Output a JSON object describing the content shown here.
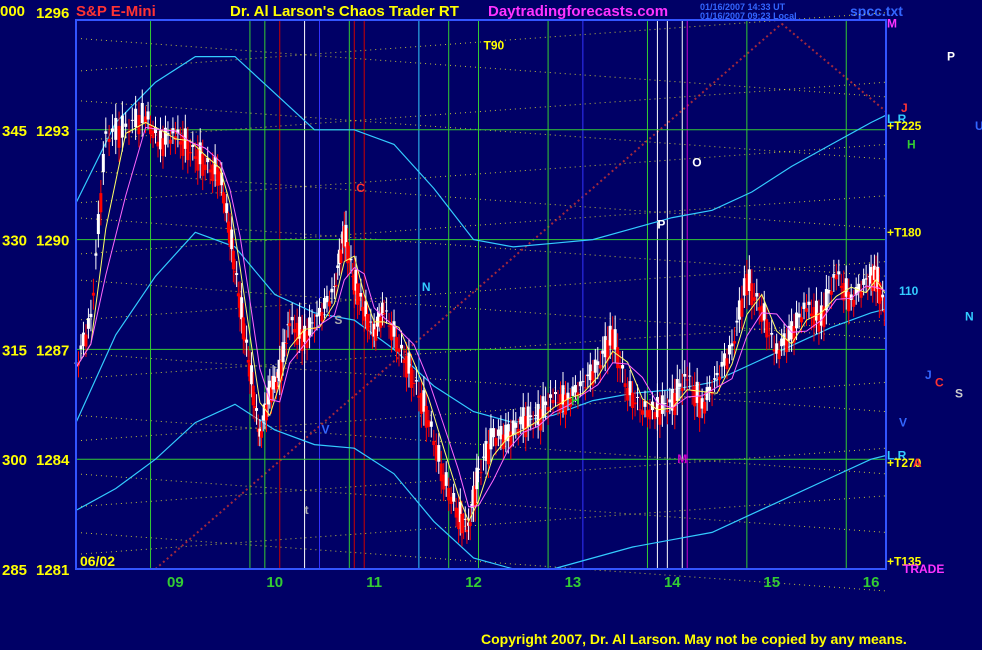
{
  "header": {
    "corner_label": "000",
    "symbol": "S&P E-Mini",
    "app_title": "Dr. Al Larson's Chaos Trader RT",
    "website": "Daytradingforecasts.com",
    "timestamp_line1": "01/16/2007 14:33 UT",
    "timestamp_line2": "01/16/2007 09:23 Local",
    "filename": "spcc.txt"
  },
  "footer": {
    "copyright": "Copyright 2007, Dr. Al Larson. May not be copied by any means."
  },
  "colors": {
    "background": "#000066",
    "grid": "#33cc33",
    "price_up": "#ffffff",
    "price_down": "#ff0000",
    "moving_avg_fast": "#ffff66",
    "moving_avg_slow": "#ff66ff",
    "envelope": "#33ccff",
    "channel_dots_yellow": "#ffff33",
    "channel_dots_red": "#cc3333",
    "axis_text": "#ffff00",
    "title_text": "#ffff00",
    "website_text": "#ff33ff",
    "copyright_text": "#ffff00"
  },
  "chart_data": {
    "type": "line",
    "series_style": "candlestick",
    "x_date_label": "06/02",
    "ylim": [
      1281,
      1296
    ],
    "y_ticks": [
      {
        "angle": "285",
        "price": "1281",
        "value": 1281
      },
      {
        "angle": "300",
        "price": "1284",
        "value": 1284
      },
      {
        "angle": "315",
        "price": "1287",
        "value": 1287
      },
      {
        "angle": "330",
        "price": "1290",
        "value": 1290
      },
      {
        "angle": "345",
        "price": "1293",
        "value": 1293
      },
      {
        "angle": "000",
        "price": "1296",
        "value": 1296
      }
    ],
    "xlim": [
      8.0,
      16.15
    ],
    "x_ticks": [
      {
        "label": "09",
        "value": 9
      },
      {
        "label": "10",
        "value": 10
      },
      {
        "label": "11",
        "value": 11
      },
      {
        "label": "12",
        "value": 12
      },
      {
        "label": "13",
        "value": 13
      },
      {
        "label": "14",
        "value": 14
      },
      {
        "label": "15",
        "value": 15
      },
      {
        "label": "16",
        "value": 16
      }
    ],
    "price": {
      "x": [
        8.0,
        8.15,
        8.3,
        8.5,
        8.7,
        8.85,
        9.0,
        9.15,
        9.3,
        9.45,
        9.55,
        9.65,
        9.75,
        9.85,
        9.95,
        10.05,
        10.15,
        10.3,
        10.45,
        10.6,
        10.7,
        10.8,
        10.9,
        11.0,
        11.1,
        11.25,
        11.4,
        11.55,
        11.7,
        11.85,
        11.95,
        12.05,
        12.2,
        12.35,
        12.5,
        12.65,
        12.8,
        12.95,
        13.1,
        13.25,
        13.4,
        13.55,
        13.7,
        13.85,
        14.0,
        14.15,
        14.3,
        14.45,
        14.6,
        14.75,
        14.9,
        15.05,
        15.2,
        15.35,
        15.5,
        15.65,
        15.8,
        15.95,
        16.05,
        16.15
      ],
      "y": [
        1286.5,
        1287.8,
        1292.8,
        1293.0,
        1293.4,
        1292.6,
        1292.9,
        1292.5,
        1292.1,
        1291.8,
        1290.2,
        1288.3,
        1286.5,
        1284.6,
        1285.8,
        1286.3,
        1287.8,
        1287.3,
        1287.9,
        1288.6,
        1290.2,
        1288.9,
        1288.1,
        1287.4,
        1288.1,
        1287.1,
        1286.2,
        1285.1,
        1283.5,
        1282.5,
        1282.1,
        1283.6,
        1284.6,
        1284.6,
        1285.0,
        1285.1,
        1285.7,
        1285.6,
        1286.0,
        1286.5,
        1287.4,
        1285.9,
        1285.4,
        1285.3,
        1285.5,
        1286.3,
        1285.4,
        1286.2,
        1287.0,
        1288.9,
        1288.1,
        1286.9,
        1287.4,
        1288.2,
        1287.8,
        1289.1,
        1288.3,
        1288.8,
        1289.0,
        1288.0
      ]
    },
    "envelopes": [
      {
        "x": [
          8.0,
          8.4,
          8.8,
          9.2,
          9.6,
          10.0,
          10.4,
          10.8,
          11.2,
          11.6,
          12.0,
          12.4,
          12.8,
          13.2,
          13.6,
          14.0,
          14.4,
          14.8,
          15.2,
          15.6,
          16.0,
          16.15
        ],
        "y": [
          1291.0,
          1293.2,
          1294.3,
          1295.0,
          1295.0,
          1294.0,
          1293.0,
          1293.0,
          1292.6,
          1291.4,
          1290.0,
          1289.8,
          1289.9,
          1290.0,
          1290.3,
          1290.6,
          1290.8,
          1291.3,
          1292.0,
          1292.6,
          1293.2,
          1293.4
        ]
      },
      {
        "x": [
          8.0,
          8.4,
          8.8,
          9.2,
          9.6,
          10.0,
          10.4,
          10.8,
          11.2,
          11.6,
          12.0,
          12.4,
          12.8,
          13.2,
          13.6,
          14.0,
          14.4,
          14.8,
          15.2,
          15.6,
          16.0,
          16.15
        ],
        "y": [
          1285.0,
          1287.4,
          1289.0,
          1290.2,
          1289.8,
          1288.5,
          1288.0,
          1287.8,
          1287.0,
          1286.0,
          1285.3,
          1285.0,
          1285.2,
          1285.6,
          1285.8,
          1285.9,
          1286.1,
          1286.6,
          1287.1,
          1287.6,
          1288.0,
          1288.1
        ]
      },
      {
        "x": [
          8.0,
          8.4,
          8.8,
          9.2,
          9.6,
          10.0,
          10.4,
          10.8,
          11.2,
          11.6,
          12.0,
          12.4,
          12.8,
          13.2,
          13.6,
          14.0,
          14.4,
          14.8,
          15.2,
          15.6,
          16.0,
          16.15
        ],
        "y": [
          1282.6,
          1283.2,
          1284.0,
          1285.0,
          1285.5,
          1284.8,
          1284.4,
          1284.3,
          1283.6,
          1282.3,
          1281.3,
          1281.0,
          1281.0,
          1281.3,
          1281.6,
          1281.8,
          1282.0,
          1282.5,
          1283.0,
          1283.5,
          1284.0,
          1284.1
        ]
      }
    ],
    "vertical_lines": [
      {
        "x": 8.75,
        "color": "#33cc33"
      },
      {
        "x": 9.75,
        "color": "#33cc33"
      },
      {
        "x": 10.75,
        "color": "#33cc33"
      },
      {
        "x": 11.75,
        "color": "#33cc33"
      },
      {
        "x": 12.75,
        "color": "#33cc33"
      },
      {
        "x": 13.75,
        "color": "#33cc33"
      },
      {
        "x": 14.75,
        "color": "#33cc33"
      },
      {
        "x": 15.75,
        "color": "#33cc33"
      },
      {
        "x": 9.9,
        "color": "#33cc33"
      },
      {
        "x": 10.05,
        "color": "#cc0000"
      },
      {
        "x": 10.3,
        "color": "#ffffff"
      },
      {
        "x": 10.45,
        "color": "#3333ff"
      },
      {
        "x": 10.8,
        "color": "#cc0000"
      },
      {
        "x": 10.9,
        "color": "#cc0000"
      },
      {
        "x": 11.45,
        "color": "#33ccff"
      },
      {
        "x": 12.05,
        "color": "#33cc33"
      },
      {
        "x": 13.1,
        "color": "#3333ff"
      },
      {
        "x": 13.85,
        "color": "#ffffff"
      },
      {
        "x": 13.95,
        "color": "#ffffff"
      },
      {
        "x": 14.1,
        "color": "#ffffff"
      },
      {
        "x": 14.15,
        "color": "#cc00cc"
      }
    ],
    "annotations": [
      {
        "text": "T90",
        "x": 12.1,
        "y": 1295.2,
        "color": "#ffff00"
      },
      {
        "text": "C",
        "x": 10.82,
        "y": 1291.3,
        "color": "#ff3333"
      },
      {
        "text": "N",
        "x": 11.48,
        "y": 1288.6,
        "color": "#33ccff"
      },
      {
        "text": "O",
        "x": 14.2,
        "y": 1292.0,
        "color": "#ffffff"
      },
      {
        "text": "P",
        "x": 13.85,
        "y": 1290.3,
        "color": "#ffffff"
      },
      {
        "text": "S",
        "x": 10.6,
        "y": 1287.7,
        "color": "#aaaaaa"
      },
      {
        "text": "V",
        "x": 10.47,
        "y": 1284.7,
        "color": "#3366ff"
      },
      {
        "text": "t",
        "x": 10.3,
        "y": 1282.5,
        "color": "#aaaaaa"
      },
      {
        "text": "H",
        "x": 12.98,
        "y": 1285.5,
        "color": "#33cc33"
      },
      {
        "text": "M",
        "x": 14.05,
        "y": 1283.9,
        "color": "#cc00cc"
      }
    ],
    "right_labels": [
      {
        "text": "M",
        "y": 1295.9,
        "dx": 0,
        "color": "#ff33ff"
      },
      {
        "text": "P",
        "y": 1295.0,
        "dx": 60,
        "color": "#ffffff"
      },
      {
        "text": "J",
        "y": 1293.6,
        "dx": 14,
        "color": "#ff3333"
      },
      {
        "text": "L.R",
        "y": 1293.3,
        "dx": 0,
        "color": "#33ccff"
      },
      {
        "text": "+T225",
        "y": 1293.1,
        "dx": 0,
        "color": "#ffff00"
      },
      {
        "text": "U",
        "y": 1293.1,
        "dx": 88,
        "color": "#3366ff"
      },
      {
        "text": "H",
        "y": 1292.6,
        "dx": 20,
        "color": "#33cc33"
      },
      {
        "text": "+T180",
        "y": 1290.2,
        "dx": 0,
        "color": "#ffff00"
      },
      {
        "text": "110",
        "y": 1288.6,
        "dx": 12,
        "color": "#33ccff"
      },
      {
        "text": "N",
        "y": 1287.9,
        "dx": 78,
        "color": "#33ccff"
      },
      {
        "text": "J",
        "y": 1286.3,
        "dx": 38,
        "color": "#3366ff"
      },
      {
        "text": "C",
        "y": 1286.1,
        "dx": 48,
        "color": "#ff3333"
      },
      {
        "text": "S",
        "y": 1285.8,
        "dx": 68,
        "color": "#cccccc"
      },
      {
        "text": "V",
        "y": 1285.0,
        "dx": 12,
        "color": "#3366ff"
      },
      {
        "text": "L.R",
        "y": 1284.1,
        "dx": 0,
        "color": "#33ccff"
      },
      {
        "text": "+T270",
        "y": 1283.9,
        "dx": 0,
        "color": "#ffff00"
      },
      {
        "text": "A",
        "y": 1283.9,
        "dx": 26,
        "color": "#ff3333"
      },
      {
        "text": "+T135",
        "y": 1281.2,
        "dx": 0,
        "color": "#ffff00"
      },
      {
        "text": "TRADE",
        "y": 1281.0,
        "dx": 16,
        "color": "#ff33ff"
      }
    ]
  }
}
